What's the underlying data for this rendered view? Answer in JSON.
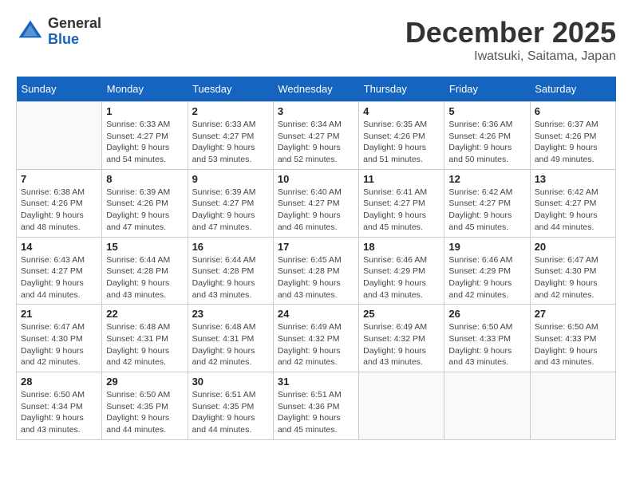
{
  "header": {
    "logo_general": "General",
    "logo_blue": "Blue",
    "month": "December 2025",
    "location": "Iwatsuki, Saitama, Japan"
  },
  "weekdays": [
    "Sunday",
    "Monday",
    "Tuesday",
    "Wednesday",
    "Thursday",
    "Friday",
    "Saturday"
  ],
  "weeks": [
    [
      {
        "day": "",
        "info": ""
      },
      {
        "day": "1",
        "info": "Sunrise: 6:33 AM\nSunset: 4:27 PM\nDaylight: 9 hours\nand 54 minutes."
      },
      {
        "day": "2",
        "info": "Sunrise: 6:33 AM\nSunset: 4:27 PM\nDaylight: 9 hours\nand 53 minutes."
      },
      {
        "day": "3",
        "info": "Sunrise: 6:34 AM\nSunset: 4:27 PM\nDaylight: 9 hours\nand 52 minutes."
      },
      {
        "day": "4",
        "info": "Sunrise: 6:35 AM\nSunset: 4:26 PM\nDaylight: 9 hours\nand 51 minutes."
      },
      {
        "day": "5",
        "info": "Sunrise: 6:36 AM\nSunset: 4:26 PM\nDaylight: 9 hours\nand 50 minutes."
      },
      {
        "day": "6",
        "info": "Sunrise: 6:37 AM\nSunset: 4:26 PM\nDaylight: 9 hours\nand 49 minutes."
      }
    ],
    [
      {
        "day": "7",
        "info": "Sunrise: 6:38 AM\nSunset: 4:26 PM\nDaylight: 9 hours\nand 48 minutes."
      },
      {
        "day": "8",
        "info": "Sunrise: 6:39 AM\nSunset: 4:26 PM\nDaylight: 9 hours\nand 47 minutes."
      },
      {
        "day": "9",
        "info": "Sunrise: 6:39 AM\nSunset: 4:27 PM\nDaylight: 9 hours\nand 47 minutes."
      },
      {
        "day": "10",
        "info": "Sunrise: 6:40 AM\nSunset: 4:27 PM\nDaylight: 9 hours\nand 46 minutes."
      },
      {
        "day": "11",
        "info": "Sunrise: 6:41 AM\nSunset: 4:27 PM\nDaylight: 9 hours\nand 45 minutes."
      },
      {
        "day": "12",
        "info": "Sunrise: 6:42 AM\nSunset: 4:27 PM\nDaylight: 9 hours\nand 45 minutes."
      },
      {
        "day": "13",
        "info": "Sunrise: 6:42 AM\nSunset: 4:27 PM\nDaylight: 9 hours\nand 44 minutes."
      }
    ],
    [
      {
        "day": "14",
        "info": "Sunrise: 6:43 AM\nSunset: 4:27 PM\nDaylight: 9 hours\nand 44 minutes."
      },
      {
        "day": "15",
        "info": "Sunrise: 6:44 AM\nSunset: 4:28 PM\nDaylight: 9 hours\nand 43 minutes."
      },
      {
        "day": "16",
        "info": "Sunrise: 6:44 AM\nSunset: 4:28 PM\nDaylight: 9 hours\nand 43 minutes."
      },
      {
        "day": "17",
        "info": "Sunrise: 6:45 AM\nSunset: 4:28 PM\nDaylight: 9 hours\nand 43 minutes."
      },
      {
        "day": "18",
        "info": "Sunrise: 6:46 AM\nSunset: 4:29 PM\nDaylight: 9 hours\nand 43 minutes."
      },
      {
        "day": "19",
        "info": "Sunrise: 6:46 AM\nSunset: 4:29 PM\nDaylight: 9 hours\nand 42 minutes."
      },
      {
        "day": "20",
        "info": "Sunrise: 6:47 AM\nSunset: 4:30 PM\nDaylight: 9 hours\nand 42 minutes."
      }
    ],
    [
      {
        "day": "21",
        "info": "Sunrise: 6:47 AM\nSunset: 4:30 PM\nDaylight: 9 hours\nand 42 minutes."
      },
      {
        "day": "22",
        "info": "Sunrise: 6:48 AM\nSunset: 4:31 PM\nDaylight: 9 hours\nand 42 minutes."
      },
      {
        "day": "23",
        "info": "Sunrise: 6:48 AM\nSunset: 4:31 PM\nDaylight: 9 hours\nand 42 minutes."
      },
      {
        "day": "24",
        "info": "Sunrise: 6:49 AM\nSunset: 4:32 PM\nDaylight: 9 hours\nand 42 minutes."
      },
      {
        "day": "25",
        "info": "Sunrise: 6:49 AM\nSunset: 4:32 PM\nDaylight: 9 hours\nand 43 minutes."
      },
      {
        "day": "26",
        "info": "Sunrise: 6:50 AM\nSunset: 4:33 PM\nDaylight: 9 hours\nand 43 minutes."
      },
      {
        "day": "27",
        "info": "Sunrise: 6:50 AM\nSunset: 4:33 PM\nDaylight: 9 hours\nand 43 minutes."
      }
    ],
    [
      {
        "day": "28",
        "info": "Sunrise: 6:50 AM\nSunset: 4:34 PM\nDaylight: 9 hours\nand 43 minutes."
      },
      {
        "day": "29",
        "info": "Sunrise: 6:50 AM\nSunset: 4:35 PM\nDaylight: 9 hours\nand 44 minutes."
      },
      {
        "day": "30",
        "info": "Sunrise: 6:51 AM\nSunset: 4:35 PM\nDaylight: 9 hours\nand 44 minutes."
      },
      {
        "day": "31",
        "info": "Sunrise: 6:51 AM\nSunset: 4:36 PM\nDaylight: 9 hours\nand 45 minutes."
      },
      {
        "day": "",
        "info": ""
      },
      {
        "day": "",
        "info": ""
      },
      {
        "day": "",
        "info": ""
      }
    ]
  ]
}
